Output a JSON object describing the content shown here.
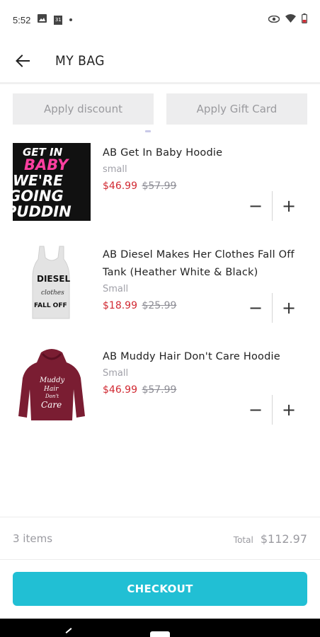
{
  "status_bar": {
    "time": "5:52",
    "calendar_day": "31",
    "icons": [
      "image-icon",
      "calendar-icon",
      "dot-icon",
      "eye-icon",
      "wifi-icon",
      "battery-icon"
    ]
  },
  "header": {
    "title": "MY BAG",
    "back_icon": "arrow-left-icon"
  },
  "promo": {
    "discount_label": "Apply discount",
    "gift_card_label": "Apply Gift Card"
  },
  "items": [
    {
      "name": "AB Get In Baby Hoodie",
      "size": "small",
      "price": "$46.99",
      "original_price": "$57.99",
      "image_text": [
        "GET IN",
        "BABY",
        "WE'RE",
        "GOING",
        "PUDDIN"
      ]
    },
    {
      "name": "AB Diesel Makes Her Clothes Fall Off Tank (Heather White & Black)",
      "size": "Small",
      "price": "$18.99",
      "original_price": "$25.99",
      "image_text": [
        "DIESEL",
        "clothes",
        "FALL OFF"
      ]
    },
    {
      "name": "AB Muddy Hair Don't Care Hoodie",
      "size": "Small",
      "price": "$46.99",
      "original_price": "$57.99",
      "image_text": [
        "Muddy",
        "Hair",
        "Don't",
        "Care"
      ]
    }
  ],
  "quantity_controls": {
    "decrement": "−",
    "increment": "+"
  },
  "summary": {
    "item_count": "3 items",
    "total_label": "Total",
    "total_value": "$112.97"
  },
  "checkout_label": "CHECKOUT",
  "colors": {
    "accent": "#21bfd4",
    "sale_price": "#d12a33",
    "muted": "#9a9aa0"
  }
}
